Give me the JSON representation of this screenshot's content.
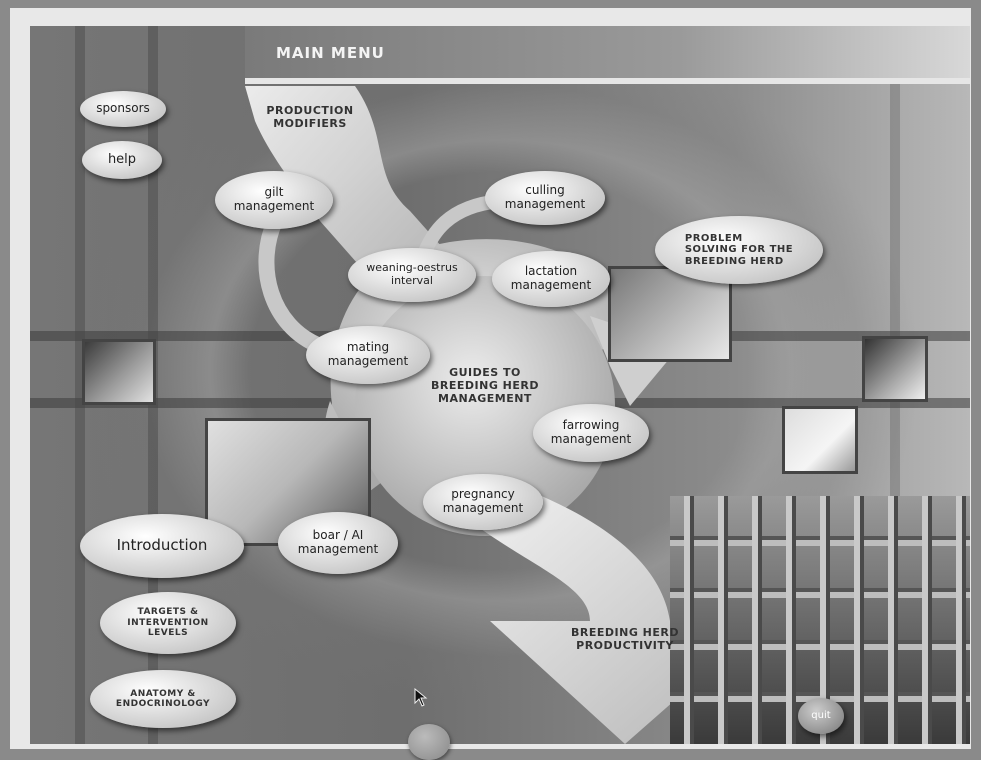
{
  "header": {
    "title": "MAIN MENU"
  },
  "side_menu": {
    "sponsors": "sponsors",
    "help": "help",
    "introduction": "Introduction",
    "targets": "TARGETS &\nINTERVENTION\nLEVELS",
    "anatomy": "ANATOMY &\nENDOCRINOLOGY"
  },
  "diagram": {
    "production_modifiers": "PRODUCTION\nMODIFIERS",
    "center_title": "GUIDES TO\nBREEDING HERD\nMANAGEMENT",
    "productivity": "BREEDING HERD\nPRODUCTIVITY",
    "modules": {
      "gilt": "gilt\nmanagement",
      "culling": "culling\nmanagement",
      "weaning": "weaning-oestrus\ninterval",
      "lactation": "lactation\nmanagement",
      "mating": "mating\nmanagement",
      "farrowing": "farrowing\nmanagement",
      "pregnancy": "pregnancy\nmanagement",
      "boar": "boar / AI\nmanagement"
    },
    "problem_solving": "PROBLEM\nSOLVING FOR THE\nBREEDING HERD"
  },
  "controls": {
    "quit": "quit"
  },
  "colors": {
    "background": "#767676",
    "oval": "#dddddd",
    "arrow": "#d4d4d4"
  }
}
